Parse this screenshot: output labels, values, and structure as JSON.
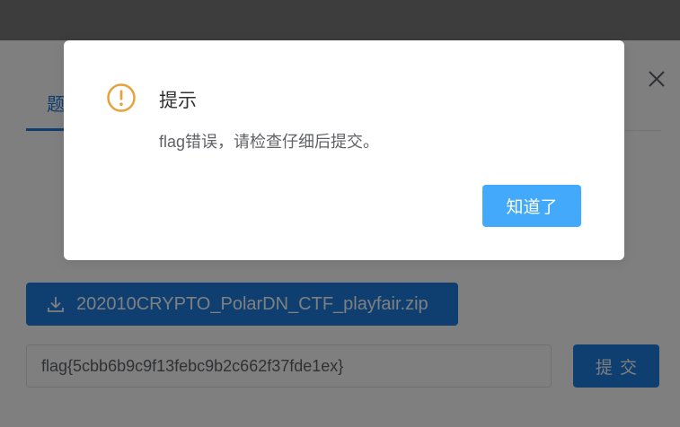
{
  "panel": {
    "tab_label": "题目",
    "download_label": "202010CRYPTO_PolarDN_CTF_playfair.zip",
    "flag_input_value": "flag{5cbb6b9c9f13febc9b2c662f37fde1ex}",
    "submit_label": "提交",
    "download_icon": "download-icon",
    "close_icon": "close-icon"
  },
  "dialog": {
    "title": "提示",
    "message": "flag错误，请检查仔细后提交。",
    "ok_label": "知道了",
    "icon": "warning-icon"
  },
  "colors": {
    "primary": "#1f7fe0",
    "dialog_button": "#42a9fb",
    "warning": "#e6a23c"
  }
}
